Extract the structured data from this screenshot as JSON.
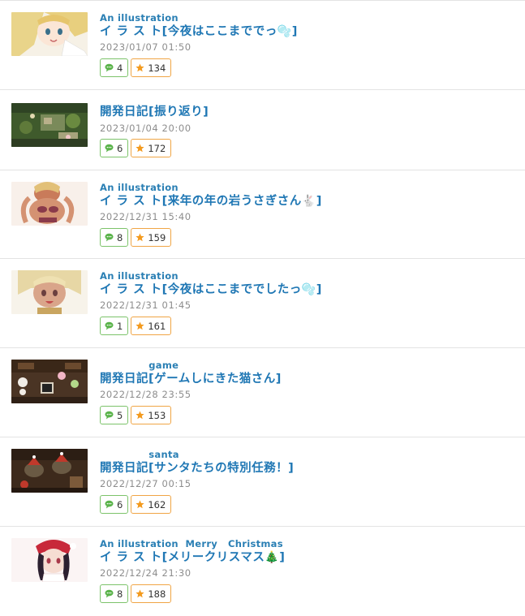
{
  "entries": [
    {
      "ruby": "An illustration",
      "title": " イ ラ ス ト[今夜はここまででっ",
      "title_suffix": "]",
      "emoji": "🫧",
      "date": "2023/01/07 01:50",
      "comments": "4",
      "favorites": "134",
      "thumb": "anime-girl-blonde"
    },
    {
      "ruby": "",
      "title": "開発日記[振り返り]",
      "title_suffix": "",
      "emoji": "",
      "date": "2023/01/04 20:00",
      "comments": "6",
      "favorites": "172",
      "thumb": "game-screenshot-garden"
    },
    {
      "ruby": "An illustration",
      "title": " イ ラ ス ト[来年の年の岩うさぎさん",
      "title_suffix": "]",
      "emoji": "🐇",
      "date": "2022/12/31 15:40",
      "comments": "8",
      "favorites": "159",
      "thumb": "anime-girl-bikini"
    },
    {
      "ruby": "An illustration",
      "title": " イ ラ ス ト[今夜はここまででしたっ",
      "title_suffix": "]",
      "emoji": "🫧",
      "date": "2022/12/31 01:45",
      "comments": "1",
      "favorites": "161",
      "thumb": "anime-girl-blonde-2"
    },
    {
      "ruby": "              game",
      "title": "開発日記[ゲームしにきた猫さん]",
      "title_suffix": "",
      "emoji": "",
      "date": "2022/12/28 23:55",
      "comments": "5",
      "favorites": "153",
      "thumb": "game-screenshot-room"
    },
    {
      "ruby": "              santa",
      "title": "開発日記[サンタたちの特別任務！]",
      "title_suffix": "",
      "emoji": "",
      "date": "2022/12/27 00:15",
      "comments": "6",
      "favorites": "162",
      "thumb": "game-screenshot-santa"
    },
    {
      "ruby": "An illustration  Merry   Christmas",
      "title": " イ ラ ス ト[メリークリスマス",
      "title_suffix": "]",
      "emoji": "🎄",
      "date": "2022/12/24 21:30",
      "comments": "8",
      "favorites": "188",
      "thumb": "anime-girl-santa"
    }
  ],
  "colors": {
    "title": "#1f77b4",
    "date": "#8d8d8d",
    "comment_border": "#7cc36a",
    "favorite_border": "#f0a545",
    "divider": "#e3e3e3"
  },
  "icons": {
    "comment": "speech-bubble-icon",
    "favorite": "star-icon"
  }
}
